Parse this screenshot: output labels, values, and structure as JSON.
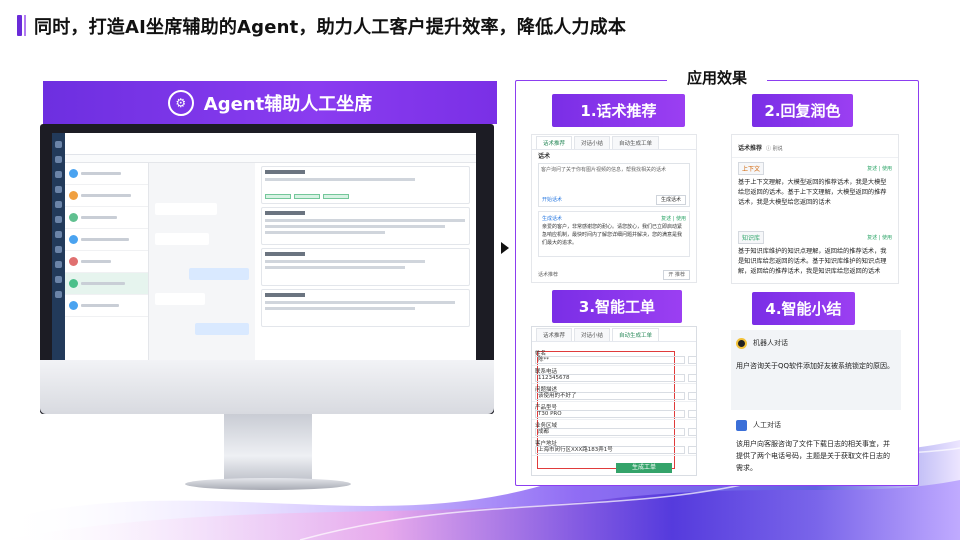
{
  "slide": {
    "title": "同时，打造AI坐席辅助的Agent，助力人工客户提升效率，降低人力成本",
    "accent_color": "#7a2ee6"
  },
  "left": {
    "banner_label": "Agent辅助人工坐席",
    "banner_icon": "brain-robot-icon"
  },
  "right": {
    "section_title": "应用效果",
    "cards": [
      {
        "label": "1.话术推荐"
      },
      {
        "label": "2.回复润色"
      },
      {
        "label": "3.智能工单"
      },
      {
        "label": "4.智能小结"
      }
    ]
  },
  "panel1": {
    "tabs": [
      "话术推荐",
      "对话小结",
      "自动生成工单"
    ],
    "section": "话术",
    "query": "客户询问了关于你有图片视频的信息，帮我找相关的话术",
    "btn_copy": "开始话术",
    "btn_gen": "生成话术",
    "result_label": "生成话术",
    "result_actions": "复述  |  使用",
    "result_text": "亲爱的客户，非常感谢您的耐心。请您放心，我们已立即启动紧急响应机制，最快时间内了解您详细问题并解决，您的满意是我们最大的追求。",
    "footer_label": "话术推荐",
    "footer_btn": "开 推荐"
  },
  "panel2": {
    "header": "话术推荐",
    "header_sub": "ⓘ 别说",
    "ctx_tag": "上下文",
    "ctx_actions": "复述 | 使用",
    "ctx_text": "基于上下文理解，大模型返回的推荐话术，我是大模型给您返回的话术。基于上下文理解，大模型返回的推荐话术，我是大模型给您返回的话术",
    "kb_tag": "知识库",
    "kb_actions": "复述 | 使用",
    "kb_text": "基于知识库维护的知识点理解，返回给的推荐话术，我是知识库给您返回的话术。基于知识库维护的知识点理解，返回给的推荐话术，我是知识库给您返回的话术"
  },
  "panel3": {
    "tabs": [
      "话术推荐",
      "对话小结",
      "自动生成工单"
    ],
    "fields": [
      {
        "label": "姓名",
        "value": "陈**"
      },
      {
        "label": "联系电话",
        "value": "112345678"
      },
      {
        "label": "问题描述",
        "value": "该使用的不好了"
      },
      {
        "label": "产品型号",
        "value": "T30 PRO"
      },
      {
        "label": "业务区域",
        "value": "成都"
      },
      {
        "label": "客户地址",
        "value": "上海市闵行区XXX路183弄1号"
      }
    ],
    "submit": "生成工单"
  },
  "panel4": {
    "robot_title": "机器人对话",
    "robot_text": "用户咨询关于QQ软件添加好友被系统锁定的原因。",
    "human_title": "人工对话",
    "human_text": "该用户向客服咨询了文件下载日志的相关事宜，并提供了两个电话号码，主题是关于获取文件日志的需求。"
  }
}
